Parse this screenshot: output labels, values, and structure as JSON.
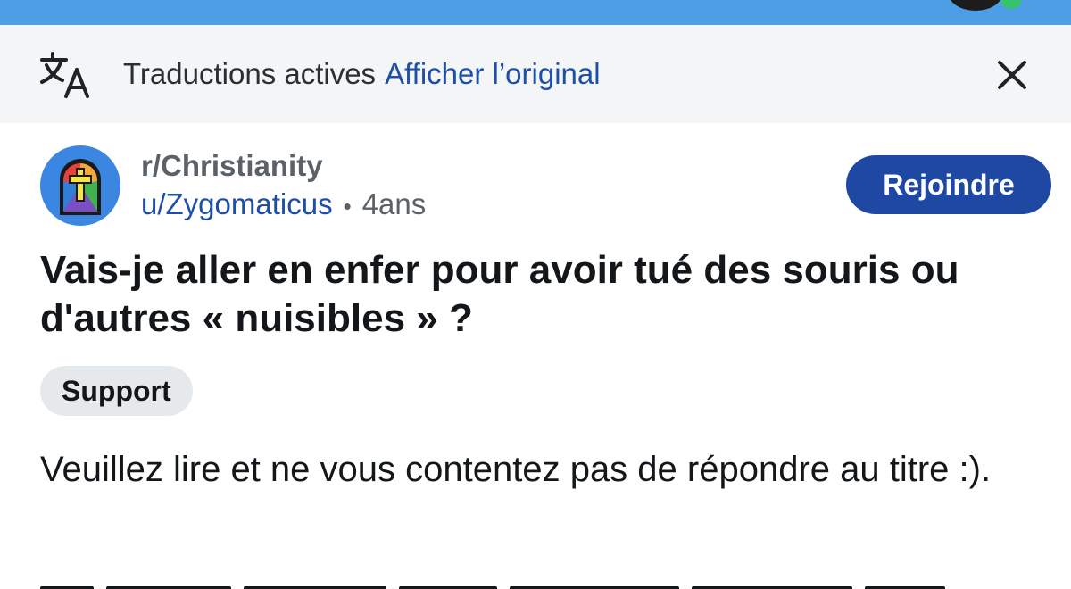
{
  "translation_bar": {
    "text": "Traductions actives",
    "link": "Afficher l’original",
    "icon": "translate-icon",
    "close_icon": "close-icon"
  },
  "post": {
    "subreddit": "r/Christianity",
    "author": "u/Zygomaticus",
    "separator": "•",
    "age": "4ans",
    "join_label": "Rejoindre",
    "title": "Vais-je aller en enfer pour avoir tué des souris ou d'autres « nuisibles » ?",
    "flair": "Support",
    "body": "Veuillez lire et ne vous contentez pas de répondre au titre :)."
  },
  "colors": {
    "top_bar": "#4e9ee6",
    "link_blue": "#1e4fa8",
    "join_button": "#1f48a3",
    "flair_bg": "#e6e9ec",
    "translation_bg": "#f3f5f7"
  }
}
